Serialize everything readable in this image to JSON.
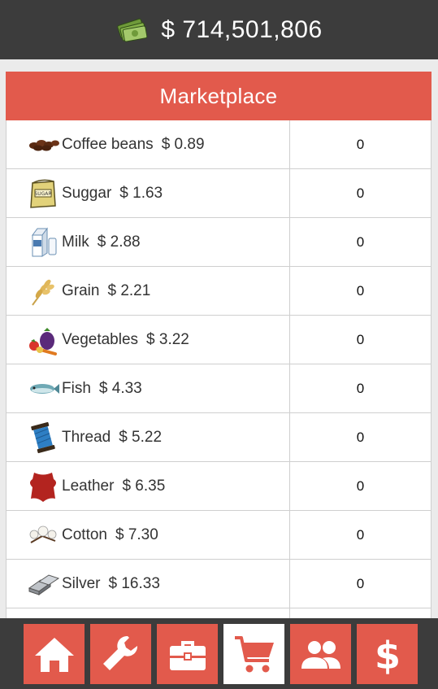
{
  "header": {
    "balance": "$ 714,501,806",
    "icon": "money-stack-icon"
  },
  "market": {
    "title": "Marketplace",
    "items": [
      {
        "name": "Coffee beans",
        "price": "$ 0.89",
        "qty": "0",
        "icon": "coffee-beans-icon"
      },
      {
        "name": "Suggar",
        "price": "$ 1.63",
        "qty": "0",
        "icon": "sugar-bag-icon"
      },
      {
        "name": "Milk",
        "price": "$ 2.88",
        "qty": "0",
        "icon": "milk-carton-icon"
      },
      {
        "name": "Grain",
        "price": "$ 2.21",
        "qty": "0",
        "icon": "grain-icon"
      },
      {
        "name": "Vegetables",
        "price": "$ 3.22",
        "qty": "0",
        "icon": "vegetables-icon"
      },
      {
        "name": "Fish",
        "price": "$ 4.33",
        "qty": "0",
        "icon": "fish-icon"
      },
      {
        "name": "Thread",
        "price": "$ 5.22",
        "qty": "0",
        "icon": "thread-spool-icon"
      },
      {
        "name": "Leather",
        "price": "$ 6.35",
        "qty": "0",
        "icon": "leather-icon"
      },
      {
        "name": "Cotton",
        "price": "$ 7.30",
        "qty": "0",
        "icon": "cotton-icon"
      },
      {
        "name": "Silver",
        "price": "$ 16.33",
        "qty": "0",
        "icon": "silver-bars-icon"
      }
    ]
  },
  "nav": {
    "items": [
      {
        "icon": "home-icon",
        "active": false
      },
      {
        "icon": "wrench-icon",
        "active": false
      },
      {
        "icon": "briefcase-icon",
        "active": false
      },
      {
        "icon": "cart-icon",
        "active": true
      },
      {
        "icon": "people-icon",
        "active": false
      },
      {
        "icon": "dollar-icon",
        "active": false
      }
    ]
  },
  "colors": {
    "accent": "#e25a4c",
    "dark": "#3c3c3c",
    "background": "#ebebeb"
  }
}
